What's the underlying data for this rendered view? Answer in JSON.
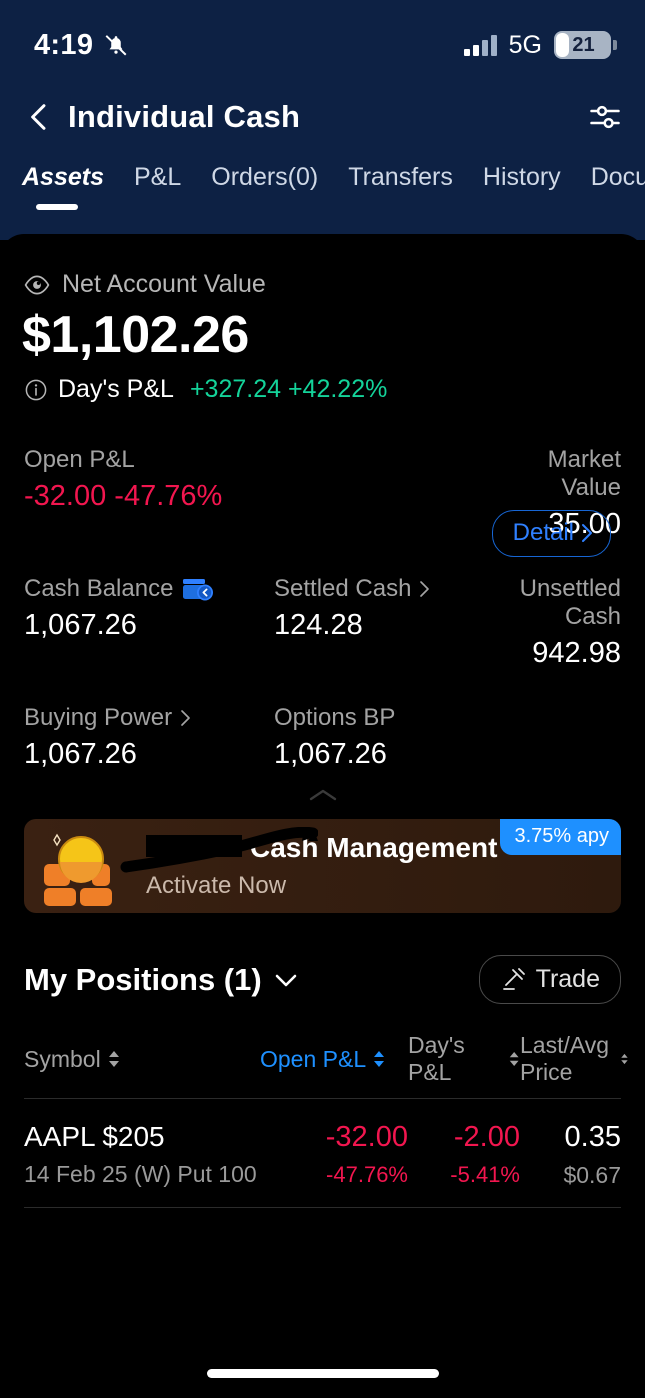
{
  "status_bar": {
    "time": "4:19",
    "mute_icon": "bell-slash-icon",
    "signal_icon": "cellular-bars-icon",
    "network": "5G",
    "battery_percent": "21"
  },
  "header": {
    "back_icon": "chevron-left-icon",
    "title": "Individual Cash",
    "filter_icon": "sliders-filter-icon"
  },
  "tabs": [
    {
      "label": "Assets",
      "active": true
    },
    {
      "label": "P&L",
      "active": false
    },
    {
      "label": "Orders(0)",
      "active": false
    },
    {
      "label": "Transfers",
      "active": false
    },
    {
      "label": "History",
      "active": false
    },
    {
      "label": "Documents",
      "active": false
    }
  ],
  "account": {
    "visibility_icon": "eye-icon",
    "net_value_label": "Net Account Value",
    "net_value": "$1,102.26",
    "info_icon": "info-circle-icon",
    "days_pl_label": "Day's P&L",
    "days_pl_value": "+327.24 +42.22%",
    "detail_button": "Detail",
    "detail_chevron_icon": "chevron-right-icon",
    "positive_color": "#14d39a",
    "negative_color": "#f2164f",
    "accent_color": "#1e90ff"
  },
  "stats": {
    "row1": [
      {
        "label": "Open P&L",
        "value": "-32.00 -47.76%",
        "negative": true,
        "icon": "",
        "align": "left"
      },
      {
        "label": "",
        "value": "",
        "negative": false,
        "icon": "",
        "align": "left"
      },
      {
        "label": "Market Value",
        "value": "35.00",
        "negative": false,
        "icon": "",
        "align": "right"
      }
    ],
    "row2": [
      {
        "label": "Cash Balance",
        "value": "1,067.26",
        "negative": false,
        "icon": "wallet-icon",
        "align": "left"
      },
      {
        "label": "Settled Cash",
        "value": "124.28",
        "negative": false,
        "icon": "chevron-right-icon",
        "align": "left"
      },
      {
        "label": "Unsettled Cash",
        "value": "942.98",
        "negative": false,
        "icon": "",
        "align": "right"
      }
    ],
    "row3": [
      {
        "label": "Buying Power",
        "value": "1,067.26",
        "negative": false,
        "icon": "chevron-right-icon",
        "align": "left"
      },
      {
        "label": "Options BP",
        "value": "1,067.26",
        "negative": false,
        "icon": "",
        "align": "left"
      },
      {
        "label": "",
        "value": "",
        "negative": false,
        "icon": "",
        "align": "right"
      }
    ],
    "collapse_icon": "chevron-up-icon"
  },
  "banner": {
    "art_icon": "coin-on-bricks-icon",
    "title": "Cash Management",
    "subtitle": "Activate Now",
    "apy_badge": "3.75% apy",
    "badge_color": "#1e90ff"
  },
  "positions": {
    "title": "My Positions (1)",
    "expand_icon": "chevron-down-icon",
    "trade_button": "Trade",
    "trade_icon": "gavel-icon",
    "columns": [
      {
        "label": "Symbol",
        "active": false,
        "sort_icon": "sort-arrows-icon"
      },
      {
        "label": "Open P&L",
        "active": true,
        "sort_icon": "sort-arrows-icon"
      },
      {
        "label": "Day's P&L",
        "active": false,
        "sort_icon": "sort-arrows-icon"
      },
      {
        "label": "Last/Avg Price",
        "active": false,
        "sort_icon": "sort-arrows-icon"
      }
    ],
    "rows": [
      {
        "symbol": "AAPL $205",
        "contract": "14 Feb 25 (W) Put 100",
        "open_pl": "-32.00",
        "open_pl_pct": "-47.76%",
        "days_pl": "-2.00",
        "days_pl_pct": "-5.41%",
        "last_price": "0.35",
        "avg_price": "$0.67"
      }
    ]
  }
}
